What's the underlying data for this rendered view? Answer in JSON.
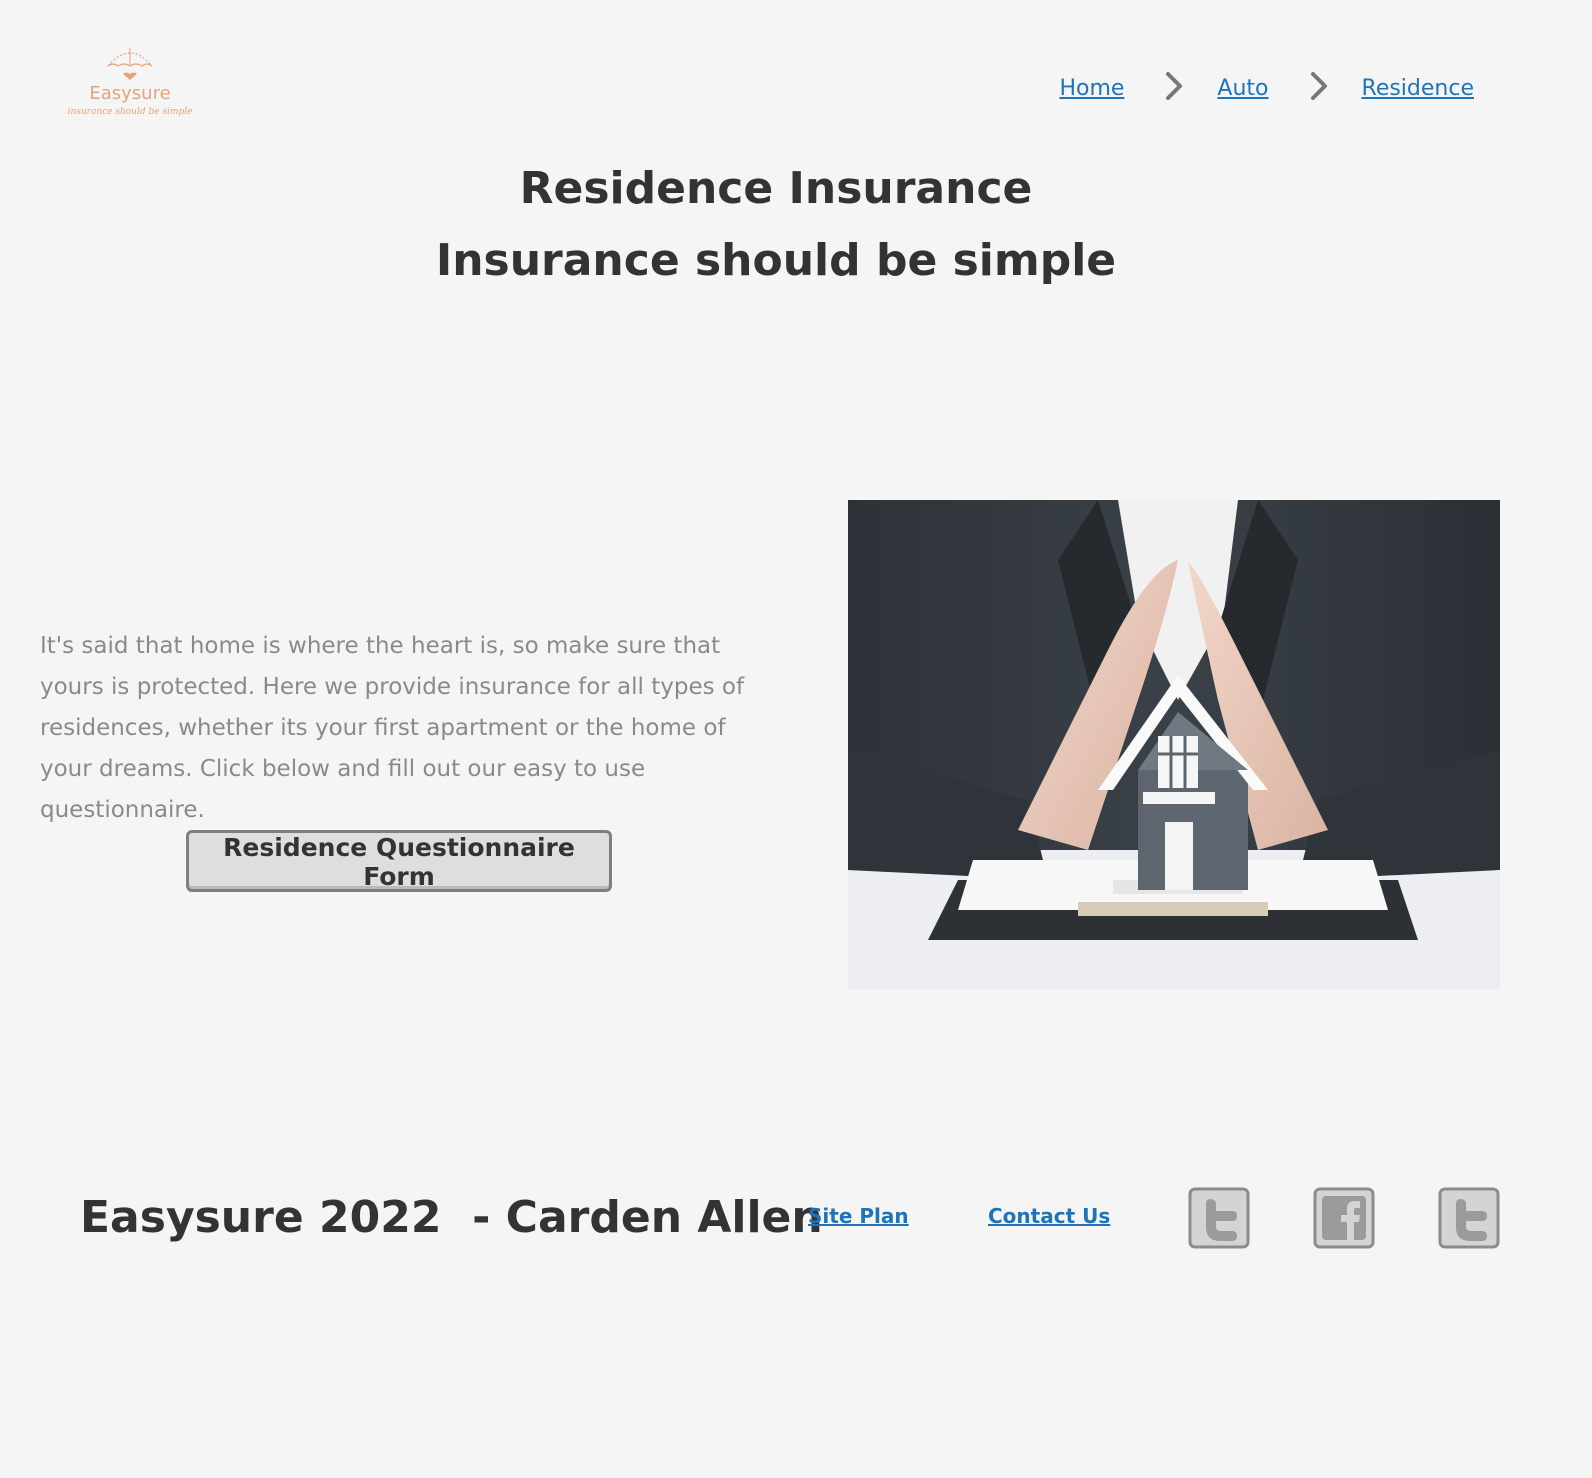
{
  "brand": {
    "name": "Easysure",
    "tagline": "insurance should be simple",
    "color": "#e8a27c"
  },
  "breadcrumb": [
    {
      "label": "Home"
    },
    {
      "label": "Auto"
    },
    {
      "label": "Residence"
    }
  ],
  "hero": {
    "title": "Residence Insurance",
    "subtitle": "Insurance should be simple"
  },
  "main": {
    "intro": "It's said that home is where the heart is, so make sure that yours is protected. Here we provide insurance for all types of residences, whether its your first apartment or the home of your dreams. Click below and fill out our easy to use questionnaire.",
    "button_label": "Residence Questionnaire Form",
    "image_icon": "hands-protecting-house-photo"
  },
  "footer": {
    "copyright": "Easysure 2022  - Carden Allen",
    "links": [
      {
        "label": "Site Plan"
      },
      {
        "label": "Contact Us"
      }
    ],
    "social": [
      {
        "icon": "twitter-icon"
      },
      {
        "icon": "facebook-icon"
      },
      {
        "icon": "twitter-icon"
      }
    ]
  },
  "colors": {
    "background": "#f5f5f5",
    "link": "#1f74b9",
    "heading": "#333333",
    "body_text": "#8a8a8a"
  }
}
